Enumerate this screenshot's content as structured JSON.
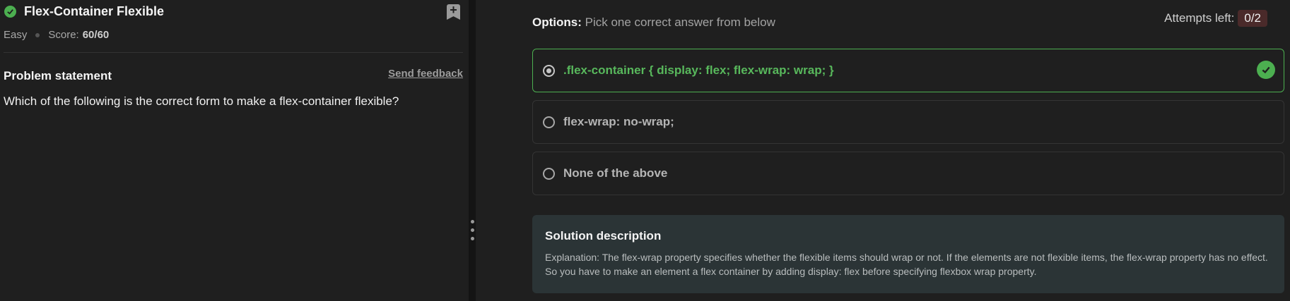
{
  "problem": {
    "title": "Flex-Container Flexible",
    "difficulty": "Easy",
    "score_label": "Score:",
    "score_value": "60/60",
    "statement_label": "Problem statement",
    "feedback_link": "Send feedback",
    "question": "Which of the following is the correct form to make a flex-container flexible?"
  },
  "options_panel": {
    "header_label": "Options:",
    "header_sub": "Pick one correct answer from below",
    "attempts_label": "Attempts left:",
    "attempts_value": "0/2",
    "options": [
      {
        "text": ".flex-container { display: flex; flex-wrap: wrap; }",
        "selected": true,
        "correct": true
      },
      {
        "text": "flex-wrap: no-wrap;",
        "selected": false,
        "correct": false
      },
      {
        "text": "None of the above",
        "selected": false,
        "correct": false
      }
    ]
  },
  "solution": {
    "title": "Solution description",
    "text": "Explanation: The flex-wrap property specifies whether the flexible items should wrap or not. If the elements are not flexible items, the flex-wrap property has no effect. So you have to make an element a flex container by adding display: flex before specifying flexbox wrap property."
  },
  "colors": {
    "success": "#4caf50",
    "background": "#1f1f1f",
    "solution_bg": "#2b3436"
  }
}
